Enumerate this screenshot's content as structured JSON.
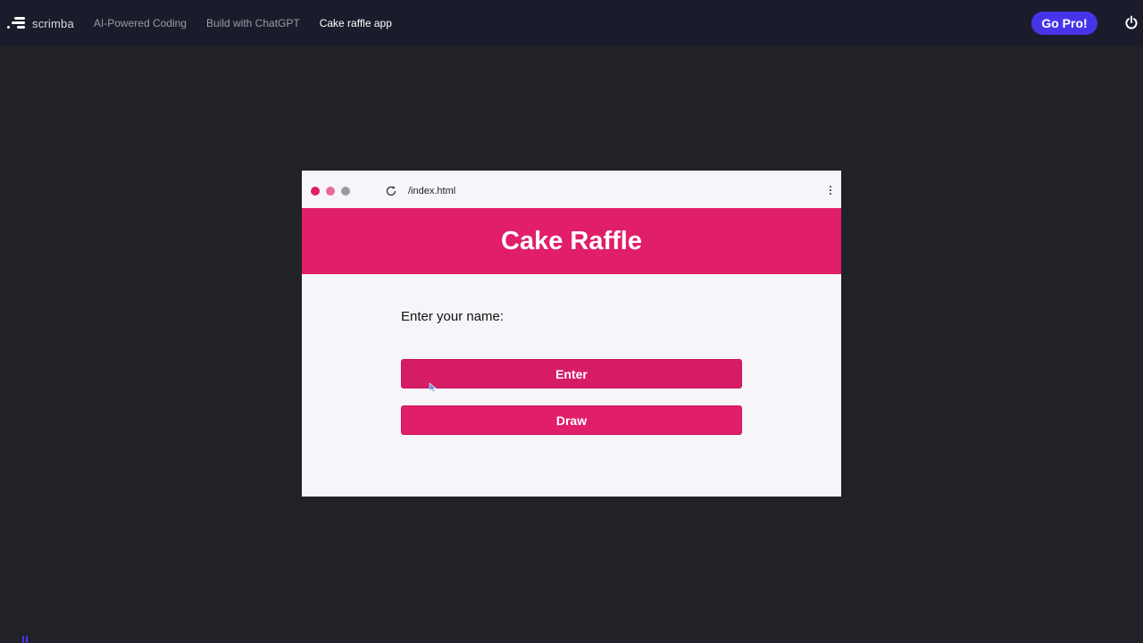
{
  "topbar": {
    "brand": "scrimba",
    "breadcrumbs": [
      {
        "label": "AI-Powered Coding"
      },
      {
        "label": "Build with ChatGPT"
      },
      {
        "label": "Cake raffle app"
      }
    ],
    "go_pro_label": "Go Pro!",
    "icons": {
      "logo": "scrimba-logo-icon",
      "power": "power-icon"
    }
  },
  "preview": {
    "url": "/index.html",
    "icons": {
      "window_dots": "window-control-dots",
      "reload": "reload-icon",
      "menu": "kebab-menu-icon"
    }
  },
  "app": {
    "title": "Cake Raffle",
    "name_label": "Enter your name:",
    "enter_button": "Enter",
    "draw_button": "Draw"
  },
  "colors": {
    "page_background": "#212228",
    "topbar_background": "#1b1c2b",
    "accent": "#e01e6a",
    "go_pro": "#4834e8",
    "preview_background": "#f7f5fa"
  }
}
